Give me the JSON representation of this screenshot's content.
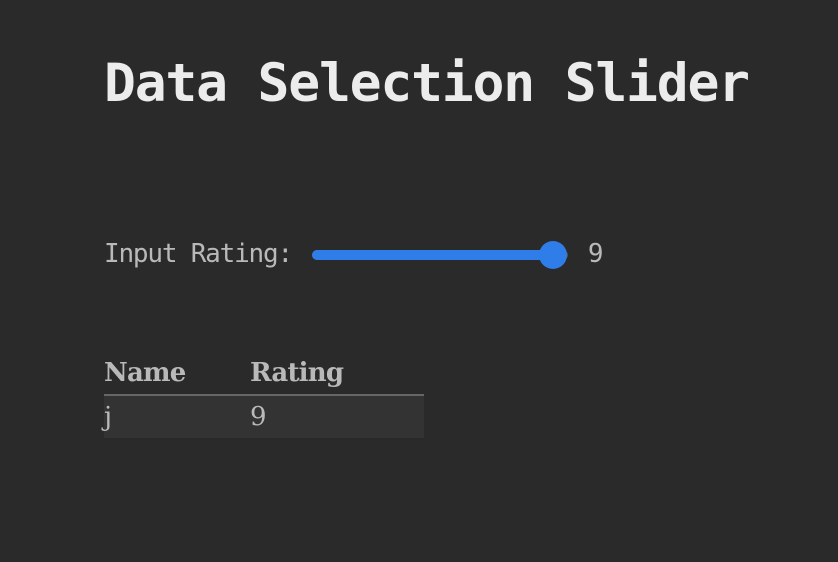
{
  "title": "Data Selection Slider",
  "slider": {
    "label": "Input Rating:",
    "value": 9,
    "value_fraction": 0.94,
    "accent_color": "#2f7de8"
  },
  "table": {
    "headers": [
      "Name",
      "Rating"
    ],
    "rows": [
      [
        "j",
        "9"
      ]
    ]
  }
}
